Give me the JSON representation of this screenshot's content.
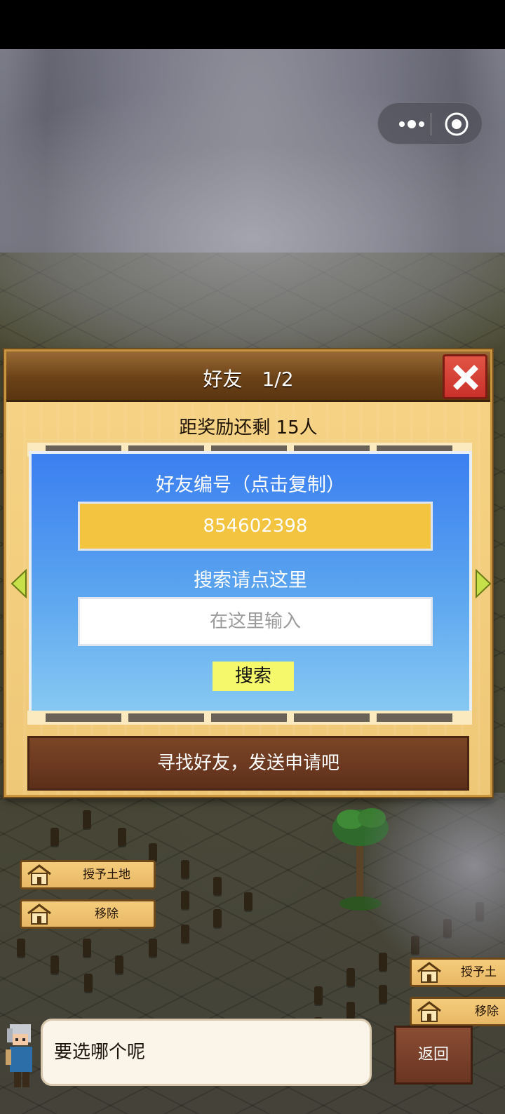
{
  "capsule": {
    "more_icon": "more-dots-icon",
    "close_icon": "target-circle-icon"
  },
  "dialog": {
    "title": "好友　1/2",
    "close_icon": "close-x-icon",
    "reward_text": "距奖励还剩 15人",
    "friend_id_label": "好友编号（点击复制）",
    "friend_id_value": "854602398",
    "search_label": "搜索请点这里",
    "search_placeholder": "在这里输入",
    "search_button": "搜索",
    "find_friends_text": "寻找好友，发送申请吧",
    "left_arrow_icon": "arrow-left-icon",
    "right_arrow_icon": "arrow-right-icon"
  },
  "world": {
    "signs_left": [
      {
        "label": "授予土地",
        "icon": "house-icon"
      },
      {
        "label": "移除",
        "icon": "house-icon"
      }
    ],
    "signs_right": [
      {
        "label": "授予土",
        "icon": "house-icon"
      },
      {
        "label": "移除",
        "icon": "house-icon"
      }
    ]
  },
  "chat": {
    "message": "要选哪个呢",
    "back_button": "返回"
  },
  "colors": {
    "panel_blue_top": "#3b7ff0",
    "panel_blue_bottom": "#87c9f3",
    "id_box_yellow": "#f3c43f",
    "search_button_yellow": "#f4f86a",
    "wood_frame": "#f3ce7c",
    "header_brown": "#6b4218",
    "close_red": "#c9302a"
  }
}
